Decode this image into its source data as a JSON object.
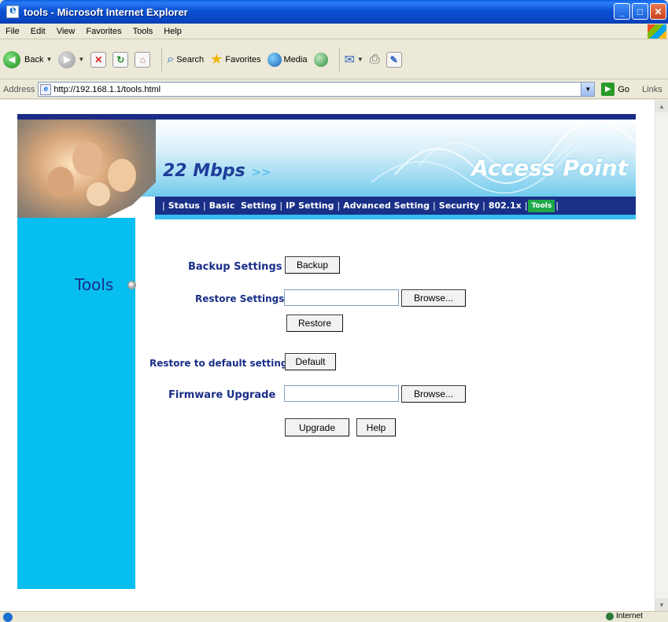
{
  "window": {
    "title": "tools - Microsoft Internet Explorer",
    "controls": {
      "minimize": "_",
      "maximize": "□",
      "close": "✕"
    }
  },
  "menubar": {
    "items": [
      "File",
      "Edit",
      "View",
      "Favorites",
      "Tools",
      "Help"
    ]
  },
  "toolbar": {
    "back_label": "Back",
    "search_label": "Search",
    "favorites_label": "Favorites",
    "media_label": "Media"
  },
  "address_bar": {
    "label": "Address",
    "url": "http://192.168.1.1/tools.html",
    "go_label": "Go",
    "links_label": "Links"
  },
  "banner": {
    "tagline": "22 Mbps",
    "tagline_arrows": ">>",
    "product": "Access Point"
  },
  "nav": {
    "items": [
      {
        "label": "Status"
      },
      {
        "label": "Basic  Setting"
      },
      {
        "label": "IP Setting"
      },
      {
        "label": "Advanced Setting"
      },
      {
        "label": "Security"
      },
      {
        "label": "802.1x"
      },
      {
        "label": "Tools",
        "active": true
      }
    ]
  },
  "sidebar": {
    "title": "Tools"
  },
  "form": {
    "backup": {
      "label": "Backup Settings",
      "button": "Backup"
    },
    "restore": {
      "label": "Restore Settings",
      "browse": "Browse...",
      "button": "Restore",
      "value": ""
    },
    "default": {
      "label": "Restore to default settings",
      "button": "Default"
    },
    "firmware": {
      "label": "Firmware Upgrade",
      "browse": "Browse...",
      "upgrade": "Upgrade",
      "help": "Help",
      "value": ""
    }
  },
  "statusbar": {
    "zone": "Internet"
  },
  "colors": {
    "nav_bg": "#1a2f88",
    "nav_active": "#1fa848",
    "sidebar_bg": "#06bff0",
    "label_text": "#1a2f88"
  }
}
